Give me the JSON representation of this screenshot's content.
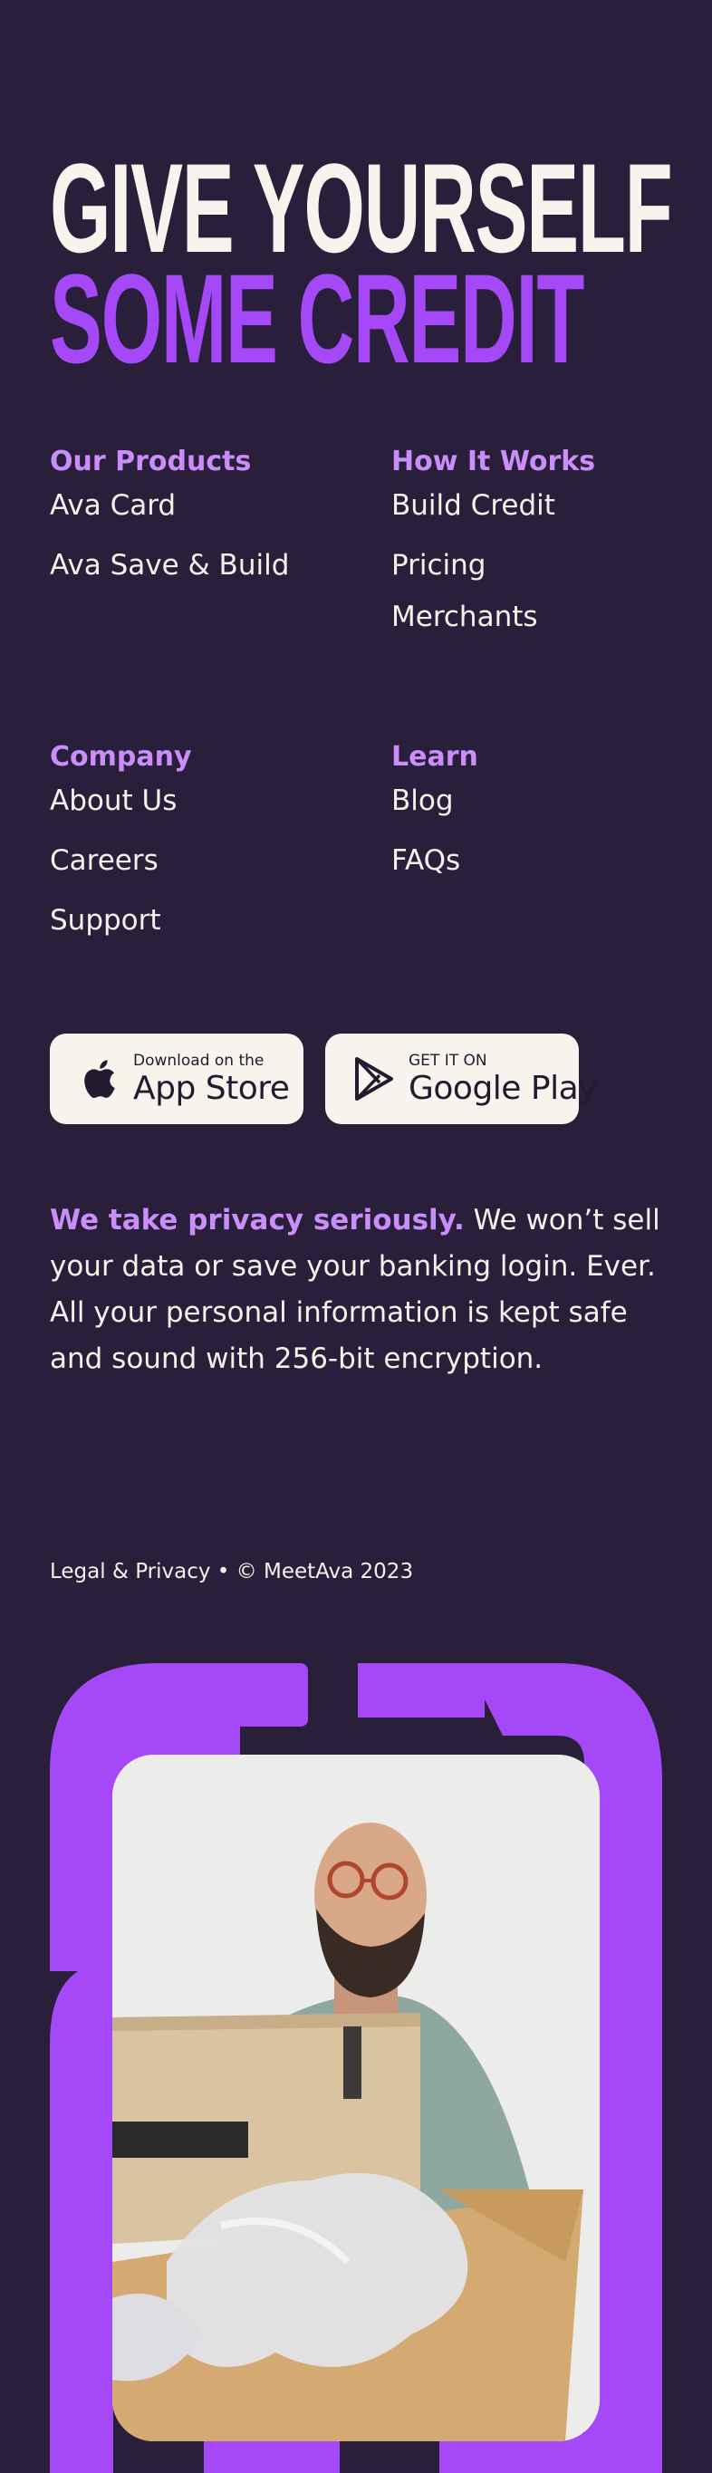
{
  "headline": {
    "line1": "GIVE YOURSELF",
    "line2": "SOME CREDIT"
  },
  "nav": {
    "products": {
      "heading": "Our Products",
      "items": [
        "Ava Card",
        "Ava Save & Build"
      ]
    },
    "how_it_works": {
      "heading": "How It Works",
      "items": [
        "Build Credit",
        "Pricing",
        "Merchants"
      ]
    },
    "company": {
      "heading": "Company",
      "items": [
        "About Us",
        "Careers",
        "Support"
      ]
    },
    "learn": {
      "heading": "Learn",
      "items": [
        "Blog",
        "FAQs"
      ]
    }
  },
  "app_store": {
    "small": "Download on the",
    "big": "App Store",
    "icon": "apple-icon"
  },
  "google_play": {
    "small": "GET IT ON",
    "big": "Google Play",
    "icon": "google-play-icon"
  },
  "privacy": {
    "strong": "We take privacy seriously.",
    "text": " We won’t sell your data or save your banking login. Ever. All your personal information is kept safe and sound with 256-bit encryption."
  },
  "footer": {
    "legal": "Legal & Privacy • © MeetAva 2023"
  },
  "colors": {
    "background": "#2a1f3a",
    "accent_purple": "#a549f8",
    "light_purple": "#c98ef9",
    "cream": "#f7f4ee"
  }
}
